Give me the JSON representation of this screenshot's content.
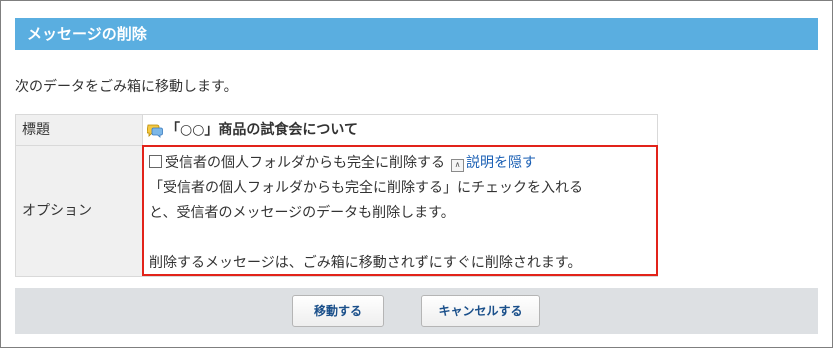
{
  "header": {
    "title": "メッセージの削除"
  },
  "intro": "次のデータをごみ箱に移動します。",
  "table": {
    "title_label": "標題",
    "title_value": "「○○」商品の試食会について",
    "option_label": "オプション",
    "option_checkbox_label": "受信者の個人フォルダからも完全に削除する",
    "hide_link": "説明を隠す",
    "desc_line1": "「受信者の個人フォルダからも完全に削除する」にチェックを入れる",
    "desc_line2": "と、受信者のメッセージのデータも削除します。",
    "desc_line3": "削除するメッセージは、ごみ箱に移動されずにすぐに削除されます。"
  },
  "buttons": {
    "move": "移動する",
    "cancel": "キャンセルする"
  }
}
